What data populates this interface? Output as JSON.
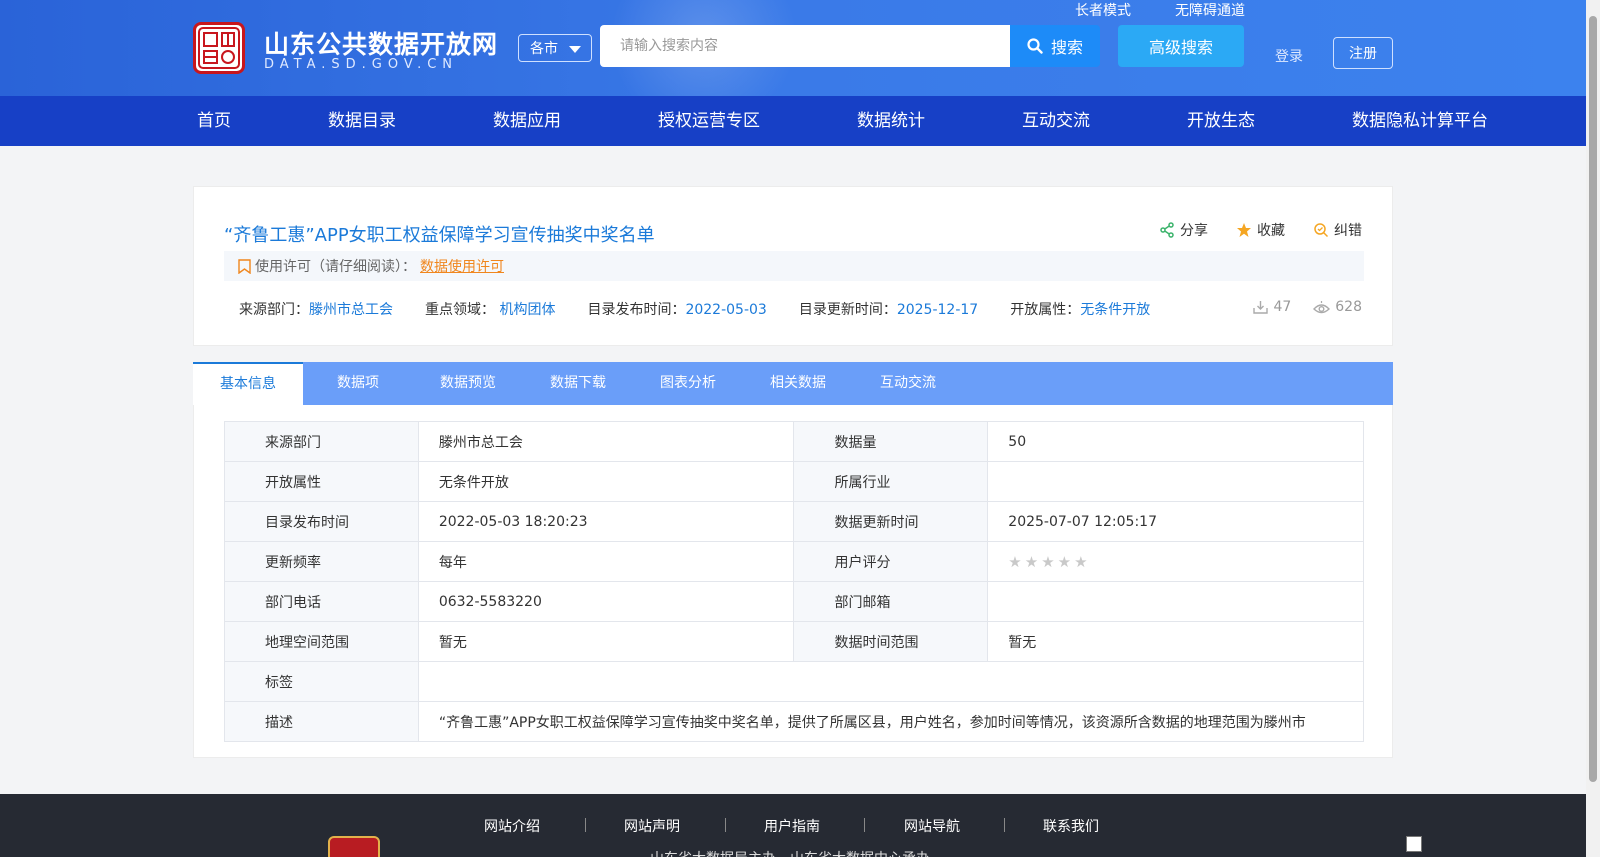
{
  "header": {
    "site_title": "山东公共数据开放网",
    "site_domain": "DATA.SD.GOV.CN",
    "city_select": "各市",
    "search_placeholder": "请输入搜索内容",
    "search_button": "搜索",
    "advanced_search": "高级搜索",
    "elder_mode": "长者模式",
    "accessibility": "无障碍通道",
    "login": "登录",
    "register": "注册"
  },
  "nav": [
    "首页",
    "数据目录",
    "数据应用",
    "授权运营专区",
    "数据统计",
    "互动交流",
    "开放生态",
    "数据隐私计算平台"
  ],
  "dataset": {
    "title": "“齐鲁工惠”APP女职工权益保障学习宣传抽奖中奖名单",
    "actions": {
      "share": "分享",
      "favorite": "收藏",
      "report": "纠错"
    },
    "license_label": "使用许可（请仔细阅读）：",
    "license_link": "数据使用许可",
    "meta": {
      "source_label": "来源部门：",
      "source": "滕州市总工会",
      "domain_label": "重点领域：",
      "domain": "机构团体",
      "publish_label": "目录发布时间：",
      "publish": "2022-05-03",
      "update_label": "目录更新时间：",
      "update": "2025-12-17",
      "open_label": "开放属性：",
      "open": "无条件开放"
    },
    "downloads": "47",
    "views": "628"
  },
  "tabs": [
    "基本信息",
    "数据项",
    "数据预览",
    "数据下载",
    "图表分析",
    "相关数据",
    "互动交流"
  ],
  "info_table": {
    "source_dept_label": "来源部门",
    "source_dept": "滕州市总工会",
    "data_volume_label": "数据量",
    "data_volume": "50",
    "open_attr_label": "开放属性",
    "open_attr": "无条件开放",
    "industry_label": "所属行业",
    "industry": "",
    "publish_time_label": "目录发布时间",
    "publish_time": "2022-05-03 18:20:23",
    "data_update_label": "数据更新时间",
    "data_update": "2025-07-07 12:05:17",
    "frequency_label": "更新频率",
    "frequency": "每年",
    "rating_label": "用户评分",
    "rating": 0,
    "phone_label": "部门电话",
    "phone": "0632-5583220",
    "email_label": "部门邮箱",
    "email": "",
    "geo_label": "地理空间范围",
    "geo": "暂无",
    "time_range_label": "数据时间范围",
    "time_range": "暂无",
    "tags_label": "标签",
    "tags": "",
    "desc_label": "描述",
    "desc": "“齐鲁工惠”APP女职工权益保障学习宣传抽奖中奖名单，提供了所属区县，用户姓名，参加时间等情况，该资源所含数据的地理范围为滕州市"
  },
  "footer": {
    "links": [
      "网站介绍",
      "网站声明",
      "用户指南",
      "网站导航",
      "联系我们"
    ],
    "sponsor": "山东省大数据局主办　山东省大数据中心承办"
  },
  "colors": {
    "header_blue": "#2a63d8",
    "nav_blue": "#1740c6",
    "link_blue": "#1b7ad9",
    "license_orange": "#f0861d",
    "tab_blue": "#6a9ef9"
  }
}
